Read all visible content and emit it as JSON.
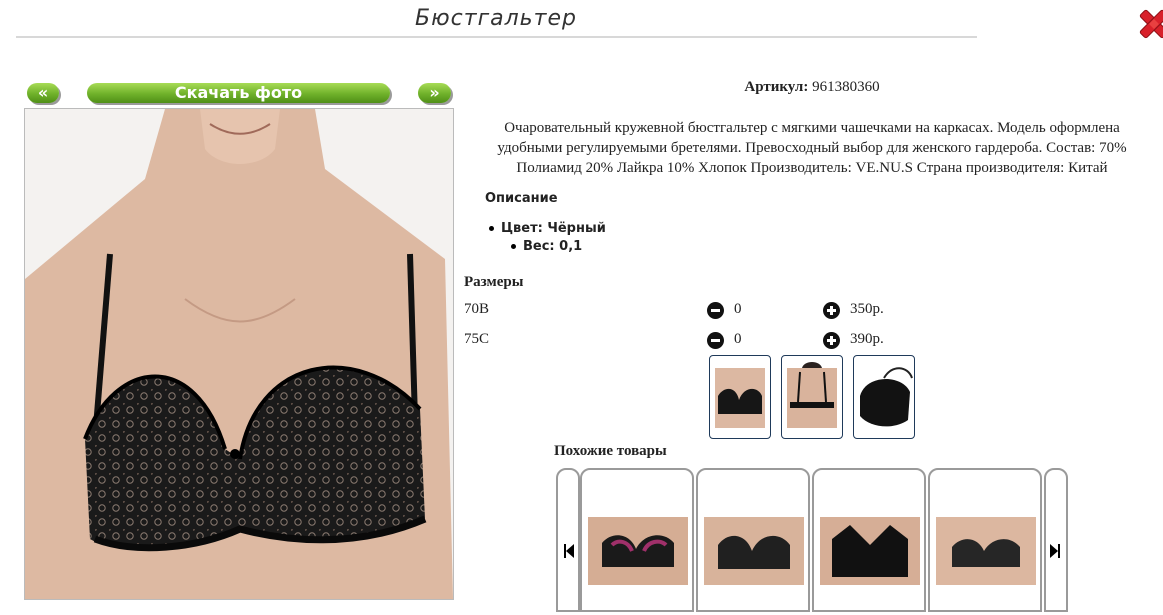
{
  "page": {
    "title": "Бюстгальтер"
  },
  "nav": {
    "prev_label": "«",
    "download_label": "Скачать фото",
    "next_label": "»"
  },
  "product": {
    "article_label": "Артикул:",
    "article_value": "961380360",
    "description": "Очаровательный кружевной бюстгальтер с мягкими чашечками на каркасах. Модель оформлена удобными регулируемыми бретелями. Превосходный выбор для женского гардероба. Состав: 70% Полиамид 20% Лайкра 10% Хлопок Производитель: VE.NU.S Страна производителя: Китай",
    "description_heading": "Описание",
    "props": [
      {
        "text": "Цвет: Чёрный"
      },
      {
        "text": "Вес: 0,1"
      }
    ]
  },
  "sizes": {
    "heading": "Размеры",
    "rows": [
      {
        "name": "70B",
        "qty": "0",
        "price": "350р."
      },
      {
        "name": "75C",
        "qty": "0",
        "price": "390р."
      }
    ]
  },
  "similar": {
    "heading": "Похожие товары"
  },
  "icons": {
    "close": "close-icon",
    "minus": "minus-circle-icon",
    "plus": "plus-circle-icon",
    "carousel_prev": "skip-back-icon",
    "carousel_next": "skip-forward-icon"
  },
  "colors": {
    "accent_green": "#6fb12a",
    "close_red": "#d8202a",
    "thumb_border": "#1f3a5a"
  }
}
